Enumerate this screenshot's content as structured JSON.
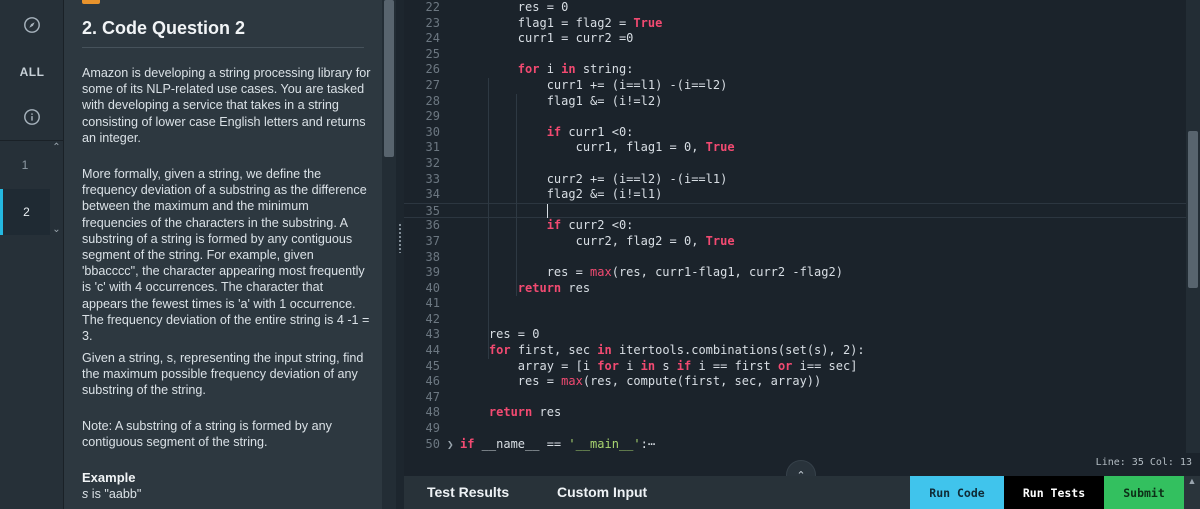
{
  "nav": {
    "all_label": "ALL",
    "questions": [
      "1",
      "2"
    ],
    "active_question": "2"
  },
  "question": {
    "title": "2. Code Question 2",
    "paragraphs": [
      "Amazon is developing a string processing library for some of its NLP-related use cases. You are tasked with developing a service that takes in a string consisting of lower case English letters and returns an integer.",
      "More formally, given a string, we define the frequency deviation of a substring as the difference between the maximum and the minimum frequencies of the characters in the substring. A substring of a string is formed by any contiguous segment of the string. For example, given 'bbacccc\", the character appearing most frequently is 'c' with 4 occurrences. The character that appears the fewest times is 'a' with 1 occurrence. The frequency deviation of the entire string is 4 -1 = 3.",
      "Given a string, s, representing the input string, find the maximum possible frequency deviation of any substring of the string.",
      "Note: A substring of a string is formed by any contiguous segment of the string."
    ],
    "example_title": "Example",
    "example_var": "s",
    "example_rest": " is \"aabb\""
  },
  "editor": {
    "lines": [
      {
        "n": "22",
        "code": "        res = 0"
      },
      {
        "n": "23",
        "code": "        flag1 = flag2 = True"
      },
      {
        "n": "24",
        "code": "        curr1 = curr2 =0"
      },
      {
        "n": "25",
        "code": ""
      },
      {
        "n": "26",
        "code": "        for i in string:"
      },
      {
        "n": "27",
        "code": "            curr1 += (i==l1) -(i==l2)"
      },
      {
        "n": "28",
        "code": "            flag1 &= (i!=l2)"
      },
      {
        "n": "29",
        "code": ""
      },
      {
        "n": "30",
        "code": "            if curr1 <0:"
      },
      {
        "n": "31",
        "code": "                curr1, flag1 = 0, True"
      },
      {
        "n": "32",
        "code": ""
      },
      {
        "n": "33",
        "code": "            curr2 += (i==l2) -(i==l1)"
      },
      {
        "n": "34",
        "code": "            flag2 &= (i!=l1)"
      },
      {
        "n": "35",
        "code": "            "
      },
      {
        "n": "36",
        "code": "            if curr2 <0:"
      },
      {
        "n": "37",
        "code": "                curr2, flag2 = 0, True"
      },
      {
        "n": "38",
        "code": ""
      },
      {
        "n": "39",
        "code": "            res = max(res, curr1-flag1, curr2 -flag2)"
      },
      {
        "n": "40",
        "code": "        return res"
      },
      {
        "n": "41",
        "code": ""
      },
      {
        "n": "42",
        "code": ""
      },
      {
        "n": "43",
        "code": "    res = 0"
      },
      {
        "n": "44",
        "code": "    for first, sec in itertools.combinations(set(s), 2):"
      },
      {
        "n": "45",
        "code": "        array = [i for i in s if i == first or i== sec]"
      },
      {
        "n": "46",
        "code": "        res = max(res, compute(first, sec, array))"
      },
      {
        "n": "47",
        "code": ""
      },
      {
        "n": "48",
        "code": "    return res"
      },
      {
        "n": "49",
        "code": ""
      },
      {
        "n": "50",
        "code": "if __name__ == '__main__':⋯"
      }
    ],
    "active_line": "35",
    "keywords": [
      "for",
      "in",
      "if",
      "or",
      "return",
      "True"
    ],
    "functions": [
      "max"
    ],
    "status": "Line: 35 Col: 13"
  },
  "bottom": {
    "tabs": [
      "Test Results",
      "Custom Input"
    ],
    "run_code": "Run Code",
    "run_tests": "Run Tests",
    "submit": "Submit"
  },
  "colors": {
    "keyword": "#f24a71",
    "string": "#a8d46f",
    "run_code": "#40c4ec",
    "run_tests": "#000000",
    "submit": "#33c05f"
  }
}
